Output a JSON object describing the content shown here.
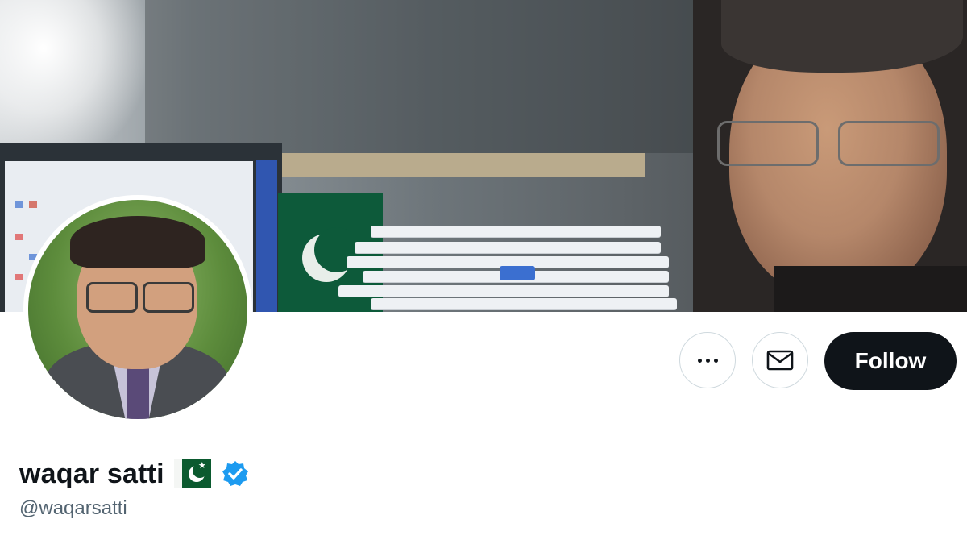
{
  "profile": {
    "display_name": "waqar satti",
    "handle": "@waqarsatti",
    "flag_icon": "pakistan-flag-icon",
    "verified_icon": "verified-badge-icon",
    "verified_color": "#1d9bf0"
  },
  "actions": {
    "more_icon": "more-options-icon",
    "message_icon": "envelope-icon",
    "follow_label": "Follow"
  },
  "colors": {
    "follow_bg": "#0f1419",
    "handle_text": "#536471"
  }
}
